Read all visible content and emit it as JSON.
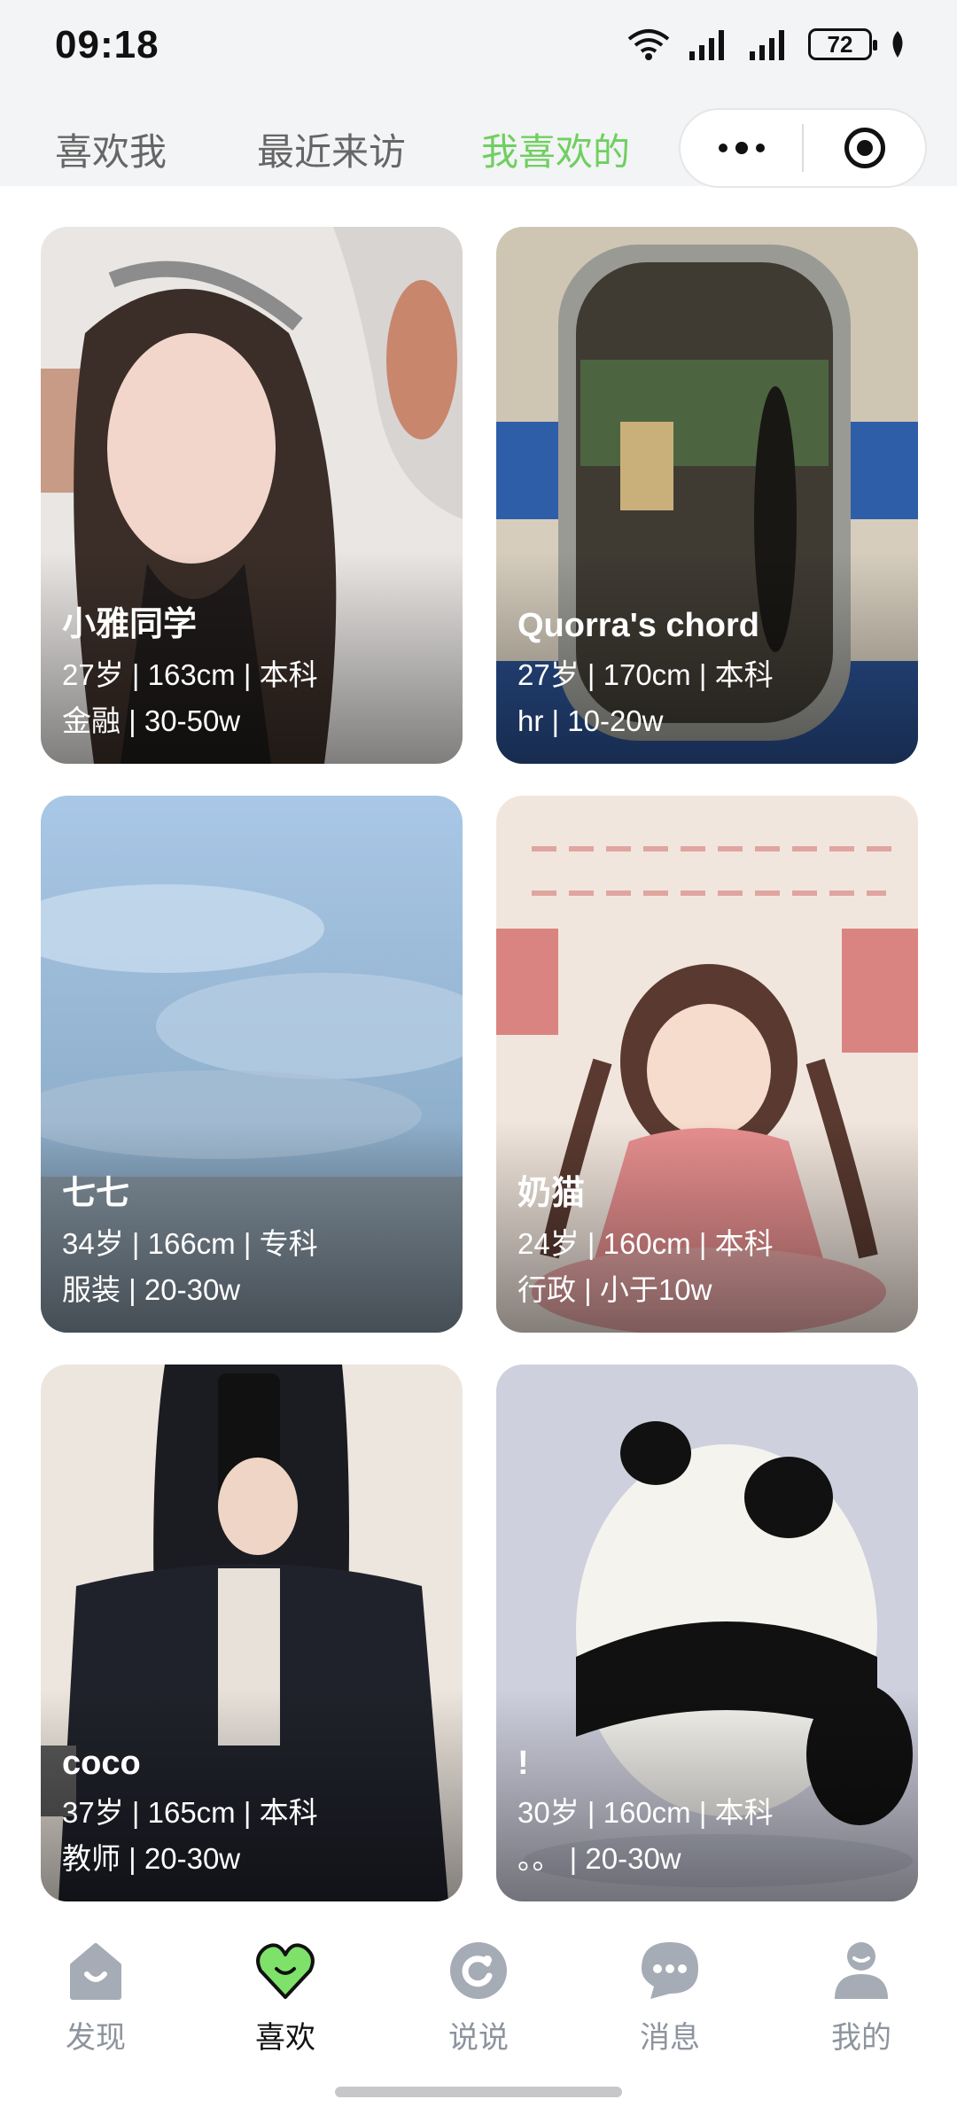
{
  "status_bar": {
    "time": "09:18",
    "battery": "72"
  },
  "tabs": [
    {
      "label": "喜欢我",
      "active": false
    },
    {
      "label": "最近来访",
      "active": false
    },
    {
      "label": "我喜欢的",
      "active": true
    }
  ],
  "capsule": {
    "more_icon": "more-dots-icon",
    "close_icon": "target-icon"
  },
  "cards": [
    {
      "name": "小雅同学",
      "line1": "27岁 | 163cm | 本科",
      "line2": "金融 | 30-50w"
    },
    {
      "name": "Quorra's chord",
      "line1": "27岁 | 170cm | 本科",
      "line2": "hr | 10-20w"
    },
    {
      "name": "七七",
      "line1": "34岁 | 166cm | 专科",
      "line2": "服装 | 20-30w"
    },
    {
      "name": "奶猫",
      "line1": "24岁 | 160cm | 本科",
      "line2": "行政 | 小于10w"
    },
    {
      "name": "coco",
      "line1": "37岁 | 165cm | 本科",
      "line2": "教师 | 20-30w"
    },
    {
      "name": "!",
      "line1": "30岁 | 160cm | 本科",
      "line2": "。。 | 20-30w"
    }
  ],
  "nav": [
    {
      "label": "发现",
      "icon": "home-icon",
      "active": false
    },
    {
      "label": "喜欢",
      "icon": "heart-icon",
      "active": true
    },
    {
      "label": "说说",
      "icon": "moments-icon",
      "active": false
    },
    {
      "label": "消息",
      "icon": "chat-icon",
      "active": false
    },
    {
      "label": "我的",
      "icon": "profile-icon",
      "active": false
    }
  ],
  "colors": {
    "accent": "#6fcf60",
    "heart": "#7ee26a",
    "nav_gray": "#8e949e"
  }
}
